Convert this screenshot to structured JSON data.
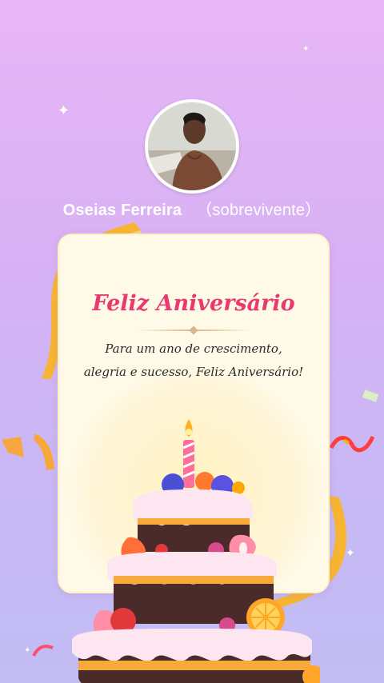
{
  "profile": {
    "name": "Oseias Ferreira",
    "tag": "（sobrevivente）"
  },
  "card": {
    "title": "Feliz Aniversário",
    "message": "Para um ano de crescimento, alegria e sucesso, Feliz Aniversário!"
  },
  "icons": [
    "sparkle-icon",
    "confetti-icon",
    "birthday-cake-icon",
    "ribbon-icon"
  ],
  "colors": {
    "title": "#e83a6f",
    "background_top": "#e9b6f6",
    "background_bottom": "#c2bdf3",
    "card": "#fff9e8",
    "ribbon": "#f7b531"
  }
}
